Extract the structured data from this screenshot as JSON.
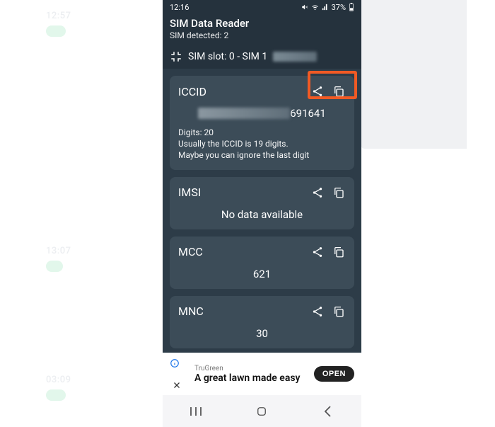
{
  "status_bar": {
    "time": "12:16",
    "battery_text": "37%"
  },
  "app": {
    "title": "SIM Data Reader",
    "subtitle": "SIM detected: 2"
  },
  "slot_header": {
    "label": "SIM slot: 0 - SIM 1"
  },
  "cards": {
    "iccid": {
      "title": "ICCID",
      "value_visible_suffix": "691641",
      "digits_line": "Digits: 20",
      "note_line1": "Usually the ICCID is 19 digits.",
      "note_line2": "Maybe you can ignore the last digit"
    },
    "imsi": {
      "title": "IMSI",
      "value": "No data available"
    },
    "mcc": {
      "title": "MCC",
      "value": "621"
    },
    "mnc": {
      "title": "MNC",
      "value": "30"
    }
  },
  "ad": {
    "brand": "TruGreen",
    "headline": "A great lawn made easy",
    "cta": "OPEN"
  },
  "ghosts": {
    "t1": "12:57",
    "t2": "13:07",
    "t3": "03:09"
  }
}
